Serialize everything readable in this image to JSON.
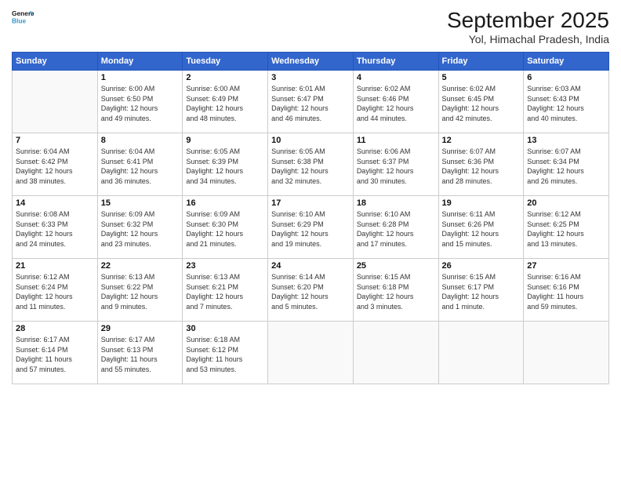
{
  "header": {
    "logo_general": "General",
    "logo_blue": "Blue",
    "month": "September 2025",
    "location": "Yol, Himachal Pradesh, India"
  },
  "weekdays": [
    "Sunday",
    "Monday",
    "Tuesday",
    "Wednesday",
    "Thursday",
    "Friday",
    "Saturday"
  ],
  "weeks": [
    [
      {
        "day": "",
        "info": ""
      },
      {
        "day": "1",
        "info": "Sunrise: 6:00 AM\nSunset: 6:50 PM\nDaylight: 12 hours\nand 49 minutes."
      },
      {
        "day": "2",
        "info": "Sunrise: 6:00 AM\nSunset: 6:49 PM\nDaylight: 12 hours\nand 48 minutes."
      },
      {
        "day": "3",
        "info": "Sunrise: 6:01 AM\nSunset: 6:47 PM\nDaylight: 12 hours\nand 46 minutes."
      },
      {
        "day": "4",
        "info": "Sunrise: 6:02 AM\nSunset: 6:46 PM\nDaylight: 12 hours\nand 44 minutes."
      },
      {
        "day": "5",
        "info": "Sunrise: 6:02 AM\nSunset: 6:45 PM\nDaylight: 12 hours\nand 42 minutes."
      },
      {
        "day": "6",
        "info": "Sunrise: 6:03 AM\nSunset: 6:43 PM\nDaylight: 12 hours\nand 40 minutes."
      }
    ],
    [
      {
        "day": "7",
        "info": "Sunrise: 6:04 AM\nSunset: 6:42 PM\nDaylight: 12 hours\nand 38 minutes."
      },
      {
        "day": "8",
        "info": "Sunrise: 6:04 AM\nSunset: 6:41 PM\nDaylight: 12 hours\nand 36 minutes."
      },
      {
        "day": "9",
        "info": "Sunrise: 6:05 AM\nSunset: 6:39 PM\nDaylight: 12 hours\nand 34 minutes."
      },
      {
        "day": "10",
        "info": "Sunrise: 6:05 AM\nSunset: 6:38 PM\nDaylight: 12 hours\nand 32 minutes."
      },
      {
        "day": "11",
        "info": "Sunrise: 6:06 AM\nSunset: 6:37 PM\nDaylight: 12 hours\nand 30 minutes."
      },
      {
        "day": "12",
        "info": "Sunrise: 6:07 AM\nSunset: 6:36 PM\nDaylight: 12 hours\nand 28 minutes."
      },
      {
        "day": "13",
        "info": "Sunrise: 6:07 AM\nSunset: 6:34 PM\nDaylight: 12 hours\nand 26 minutes."
      }
    ],
    [
      {
        "day": "14",
        "info": "Sunrise: 6:08 AM\nSunset: 6:33 PM\nDaylight: 12 hours\nand 24 minutes."
      },
      {
        "day": "15",
        "info": "Sunrise: 6:09 AM\nSunset: 6:32 PM\nDaylight: 12 hours\nand 23 minutes."
      },
      {
        "day": "16",
        "info": "Sunrise: 6:09 AM\nSunset: 6:30 PM\nDaylight: 12 hours\nand 21 minutes."
      },
      {
        "day": "17",
        "info": "Sunrise: 6:10 AM\nSunset: 6:29 PM\nDaylight: 12 hours\nand 19 minutes."
      },
      {
        "day": "18",
        "info": "Sunrise: 6:10 AM\nSunset: 6:28 PM\nDaylight: 12 hours\nand 17 minutes."
      },
      {
        "day": "19",
        "info": "Sunrise: 6:11 AM\nSunset: 6:26 PM\nDaylight: 12 hours\nand 15 minutes."
      },
      {
        "day": "20",
        "info": "Sunrise: 6:12 AM\nSunset: 6:25 PM\nDaylight: 12 hours\nand 13 minutes."
      }
    ],
    [
      {
        "day": "21",
        "info": "Sunrise: 6:12 AM\nSunset: 6:24 PM\nDaylight: 12 hours\nand 11 minutes."
      },
      {
        "day": "22",
        "info": "Sunrise: 6:13 AM\nSunset: 6:22 PM\nDaylight: 12 hours\nand 9 minutes."
      },
      {
        "day": "23",
        "info": "Sunrise: 6:13 AM\nSunset: 6:21 PM\nDaylight: 12 hours\nand 7 minutes."
      },
      {
        "day": "24",
        "info": "Sunrise: 6:14 AM\nSunset: 6:20 PM\nDaylight: 12 hours\nand 5 minutes."
      },
      {
        "day": "25",
        "info": "Sunrise: 6:15 AM\nSunset: 6:18 PM\nDaylight: 12 hours\nand 3 minutes."
      },
      {
        "day": "26",
        "info": "Sunrise: 6:15 AM\nSunset: 6:17 PM\nDaylight: 12 hours\nand 1 minute."
      },
      {
        "day": "27",
        "info": "Sunrise: 6:16 AM\nSunset: 6:16 PM\nDaylight: 11 hours\nand 59 minutes."
      }
    ],
    [
      {
        "day": "28",
        "info": "Sunrise: 6:17 AM\nSunset: 6:14 PM\nDaylight: 11 hours\nand 57 minutes."
      },
      {
        "day": "29",
        "info": "Sunrise: 6:17 AM\nSunset: 6:13 PM\nDaylight: 11 hours\nand 55 minutes."
      },
      {
        "day": "30",
        "info": "Sunrise: 6:18 AM\nSunset: 6:12 PM\nDaylight: 11 hours\nand 53 minutes."
      },
      {
        "day": "",
        "info": ""
      },
      {
        "day": "",
        "info": ""
      },
      {
        "day": "",
        "info": ""
      },
      {
        "day": "",
        "info": ""
      }
    ]
  ]
}
